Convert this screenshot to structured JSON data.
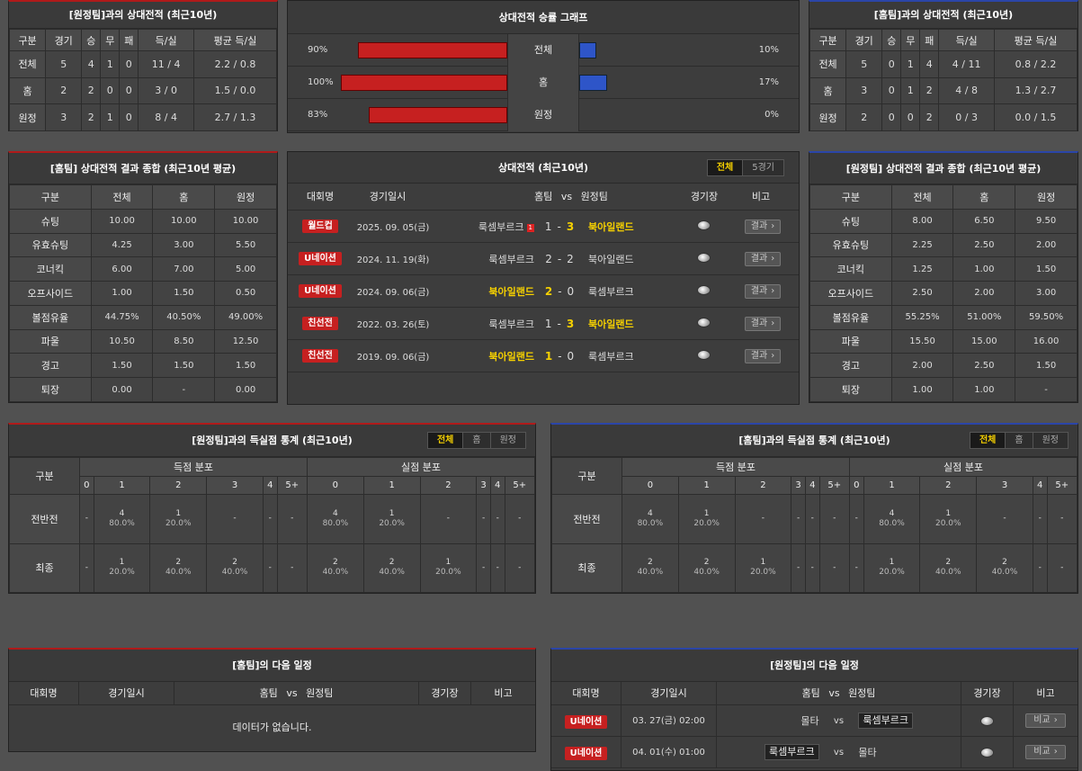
{
  "h2h_away": {
    "title": "[원정팀]과의 상대전적 (최근10년)",
    "headers": [
      "구분",
      "경기",
      "승",
      "무",
      "패",
      "득/실",
      "평균 득/실"
    ],
    "rows": [
      [
        "전체",
        "5",
        "4",
        "1",
        "0",
        "11 / 4",
        "2.2 / 0.8"
      ],
      [
        "홈",
        "2",
        "2",
        "0",
        "0",
        "3 / 0",
        "1.5 / 0.0"
      ],
      [
        "원정",
        "3",
        "2",
        "1",
        "0",
        "8 / 4",
        "2.7 / 1.3"
      ]
    ]
  },
  "graph": {
    "title": "상대전적 승률 그래프",
    "rows": [
      {
        "left": "90%",
        "label": "전체",
        "right": "10%",
        "home": 90,
        "away": 10
      },
      {
        "left": "100%",
        "label": "홈",
        "right": "17%",
        "home": 100,
        "away": 17
      },
      {
        "left": "83%",
        "label": "원정",
        "right": "0%",
        "home": 83,
        "away": 0
      }
    ]
  },
  "h2h_home": {
    "title": "[홈팀]과의 상대전적 (최근10년)",
    "headers": [
      "구분",
      "경기",
      "승",
      "무",
      "패",
      "득/실",
      "평균 득/실"
    ],
    "rows": [
      [
        "전체",
        "5",
        "0",
        "1",
        "4",
        "4 / 11",
        "0.8 / 2.2"
      ],
      [
        "홈",
        "3",
        "0",
        "1",
        "2",
        "4 / 8",
        "1.3 / 2.7"
      ],
      [
        "원정",
        "2",
        "0",
        "0",
        "2",
        "0 / 3",
        "0.0 / 1.5"
      ]
    ]
  },
  "summary_home": {
    "title": "[홈팀] 상대전적 결과 종합 (최근10년 평균)",
    "headers": [
      "구분",
      "전체",
      "홈",
      "원정"
    ],
    "rows": [
      [
        "슈팅",
        "10.00",
        "10.00",
        "10.00"
      ],
      [
        "유효슈팅",
        "4.25",
        "3.00",
        "5.50"
      ],
      [
        "코너킥",
        "6.00",
        "7.00",
        "5.00"
      ],
      [
        "오프사이드",
        "1.00",
        "1.50",
        "0.50"
      ],
      [
        "볼점유율",
        "44.75%",
        "40.50%",
        "49.00%"
      ],
      [
        "파울",
        "10.50",
        "8.50",
        "12.50"
      ],
      [
        "경고",
        "1.50",
        "1.50",
        "1.50"
      ],
      [
        "퇴장",
        "0.00",
        "-",
        "0.00"
      ]
    ]
  },
  "recent": {
    "title": "상대전적 (최근10년)",
    "tabs": [
      "전체",
      "5경기"
    ],
    "headers": {
      "league": "대회명",
      "date": "경기일시",
      "home": "홈팀",
      "vs": "vs",
      "away": "원정팀",
      "venue": "경기장",
      "note": "비고"
    },
    "button": "결과",
    "matches": [
      {
        "league": "월드컵",
        "date": "2025. 09. 05(금)",
        "home": "룩셈부르크",
        "red": "1",
        "hs": "1",
        "dash": "-",
        "as": "3",
        "away": "북아일랜드",
        "win": "away"
      },
      {
        "league": "U네이션",
        "date": "2024. 11. 19(화)",
        "home": "룩셈부르크",
        "red": "",
        "hs": "2",
        "dash": "-",
        "as": "2",
        "away": "북아일랜드",
        "win": "none"
      },
      {
        "league": "U네이션",
        "date": "2024. 09. 06(금)",
        "home": "북아일랜드",
        "red": "",
        "hs": "2",
        "dash": "-",
        "as": "0",
        "away": "룩셈부르크",
        "win": "home"
      },
      {
        "league": "친선전",
        "date": "2022. 03. 26(토)",
        "home": "룩셈부르크",
        "red": "",
        "hs": "1",
        "dash": "-",
        "as": "3",
        "away": "북아일랜드",
        "win": "away"
      },
      {
        "league": "친선전",
        "date": "2019. 09. 06(금)",
        "home": "북아일랜드",
        "red": "",
        "hs": "1",
        "dash": "-",
        "as": "0",
        "away": "룩셈부르크",
        "win": "home"
      }
    ]
  },
  "summary_away": {
    "title": "[원정팀] 상대전적 결과 종합 (최근10년 평균)",
    "headers": [
      "구분",
      "전체",
      "홈",
      "원정"
    ],
    "rows": [
      [
        "슈팅",
        "8.00",
        "6.50",
        "9.50"
      ],
      [
        "유효슈팅",
        "2.25",
        "2.50",
        "2.00"
      ],
      [
        "코너킥",
        "1.25",
        "1.00",
        "1.50"
      ],
      [
        "오프사이드",
        "2.50",
        "2.00",
        "3.00"
      ],
      [
        "볼점유율",
        "55.25%",
        "51.00%",
        "59.50%"
      ],
      [
        "파울",
        "15.50",
        "15.00",
        "16.00"
      ],
      [
        "경고",
        "2.00",
        "2.50",
        "1.50"
      ],
      [
        "퇴장",
        "1.00",
        "1.00",
        "-"
      ]
    ]
  },
  "goals_away": {
    "title": "[원정팀]과의 득실점 통계 (최근10년)",
    "tabs": [
      "전체",
      "홈",
      "원정"
    ],
    "col0": "구분",
    "scored": "득점 분포",
    "conceded": "실점 분포",
    "nums": [
      "0",
      "1",
      "2",
      "3",
      "4",
      "5+"
    ],
    "rows": [
      {
        "label": "전반전",
        "cells": [
          [
            "-",
            ""
          ],
          [
            "4",
            "80.0%"
          ],
          [
            "1",
            "20.0%"
          ],
          [
            "-",
            ""
          ],
          [
            "-",
            ""
          ],
          [
            "-",
            ""
          ],
          [
            "4",
            "80.0%"
          ],
          [
            "1",
            "20.0%"
          ],
          [
            "-",
            ""
          ],
          [
            "-",
            ""
          ],
          [
            "-",
            ""
          ],
          [
            "-",
            ""
          ]
        ]
      },
      {
        "label": "최종",
        "cells": [
          [
            "-",
            ""
          ],
          [
            "1",
            "20.0%"
          ],
          [
            "2",
            "40.0%"
          ],
          [
            "2",
            "40.0%"
          ],
          [
            "-",
            ""
          ],
          [
            "-",
            ""
          ],
          [
            "2",
            "40.0%"
          ],
          [
            "2",
            "40.0%"
          ],
          [
            "1",
            "20.0%"
          ],
          [
            "-",
            ""
          ],
          [
            "-",
            ""
          ],
          [
            "-",
            ""
          ]
        ]
      }
    ]
  },
  "goals_home": {
    "title": "[홈팀]과의 득실점 통계 (최근10년)",
    "tabs": [
      "전체",
      "홈",
      "원정"
    ],
    "col0": "구분",
    "scored": "득점 분포",
    "conceded": "실점 분포",
    "nums": [
      "0",
      "1",
      "2",
      "3",
      "4",
      "5+"
    ],
    "rows": [
      {
        "label": "전반전",
        "cells": [
          [
            "4",
            "80.0%"
          ],
          [
            "1",
            "20.0%"
          ],
          [
            "-",
            ""
          ],
          [
            "-",
            ""
          ],
          [
            "-",
            ""
          ],
          [
            "-",
            ""
          ],
          [
            "-",
            ""
          ],
          [
            "4",
            "80.0%"
          ],
          [
            "1",
            "20.0%"
          ],
          [
            "-",
            ""
          ],
          [
            "-",
            ""
          ],
          [
            "-",
            ""
          ]
        ]
      },
      {
        "label": "최종",
        "cells": [
          [
            "2",
            "40.0%"
          ],
          [
            "2",
            "40.0%"
          ],
          [
            "1",
            "20.0%"
          ],
          [
            "-",
            ""
          ],
          [
            "-",
            ""
          ],
          [
            "-",
            ""
          ],
          [
            "-",
            ""
          ],
          [
            "1",
            "20.0%"
          ],
          [
            "2",
            "40.0%"
          ],
          [
            "2",
            "40.0%"
          ],
          [
            "-",
            ""
          ],
          [
            "-",
            ""
          ]
        ]
      }
    ]
  },
  "next_home": {
    "title": "[홈팀]의 다음 일정",
    "headers": {
      "league": "대회명",
      "date": "경기일시",
      "home": "홈팀",
      "vs": "vs",
      "away": "원정팀",
      "venue": "경기장",
      "note": "비고"
    },
    "empty": "데이터가 없습니다."
  },
  "next_away": {
    "title": "[원정팀]의 다음 일정",
    "headers": {
      "league": "대회명",
      "date": "경기일시",
      "home": "홈팀",
      "vs": "vs",
      "away": "원정팀",
      "venue": "경기장",
      "note": "비고"
    },
    "button": "비교",
    "matches": [
      {
        "league": "U네이션",
        "date": "03. 27(금) 02:00",
        "home": "몰타",
        "vs": "vs",
        "away": "룩셈부르크",
        "boxed": "away"
      },
      {
        "league": "U네이션",
        "date": "04. 01(수) 01:00",
        "home": "룩셈부르크",
        "vs": "vs",
        "away": "몰타",
        "boxed": "home"
      }
    ]
  },
  "colors": {
    "home_bar": "#c62020",
    "away_bar": "#2e55c8",
    "highlight": "#f5d000"
  }
}
